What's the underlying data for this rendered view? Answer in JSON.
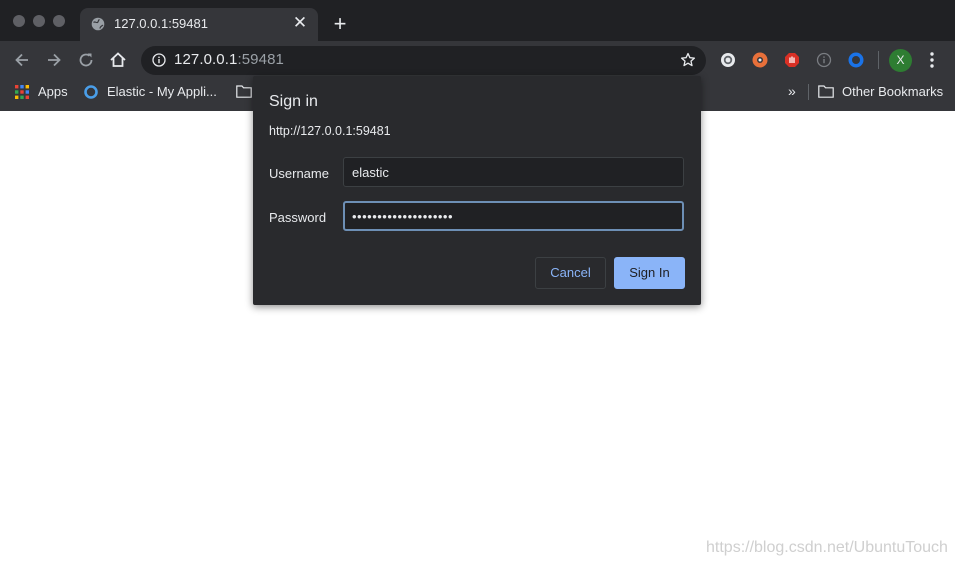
{
  "tab": {
    "title": "127.0.0.1:59481",
    "favicon": "globe-icon"
  },
  "omnibox": {
    "host": "127.0.0.1",
    "port": ":59481"
  },
  "bookmarks": {
    "apps_label": "Apps",
    "elastic_label": "Elastic - My Appli...",
    "overflow": "»",
    "other_label": "Other Bookmarks"
  },
  "profile": {
    "initial": "X",
    "color": "#2e7d32"
  },
  "dialog": {
    "title": "Sign in",
    "origin": "http://127.0.0.1:59481",
    "username_label": "Username",
    "username_value": "elastic",
    "password_label": "Password",
    "password_value": "••••••••••••••••••••",
    "cancel_label": "Cancel",
    "signin_label": "Sign In"
  },
  "colors": {
    "accent": "#8ab4f8",
    "dialog_bg": "#292a2d",
    "chrome_bg": "#35363a"
  },
  "watermark": "https://blog.csdn.net/UbuntuTouch"
}
